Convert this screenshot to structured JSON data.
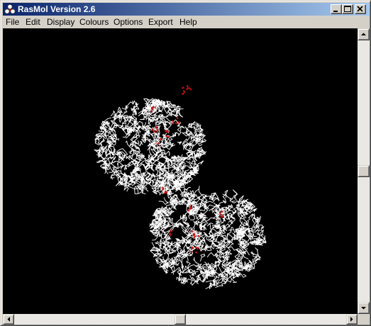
{
  "window": {
    "title": "RasMol Version 2.6",
    "icon": "rasmol-app-icon",
    "controls": [
      "minimize-icon",
      "maximize-icon",
      "close-icon"
    ]
  },
  "menu": {
    "items": [
      {
        "label": "File"
      },
      {
        "label": "Edit"
      },
      {
        "label": "Display"
      },
      {
        "label": "Colours"
      },
      {
        "label": "Options"
      },
      {
        "label": "Export"
      },
      {
        "label": "Help"
      }
    ]
  },
  "viewer": {
    "background": "#000000",
    "structure_color": "#ffffff",
    "highlight_color": "#cc1111",
    "render_style": "wireframe"
  },
  "scrollbars": {
    "vertical_position": 0.5,
    "horizontal_position": 0.5
  }
}
